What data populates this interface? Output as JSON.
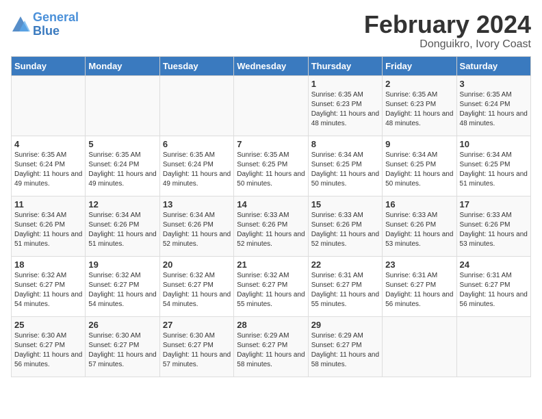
{
  "header": {
    "logo_line1": "General",
    "logo_line2": "Blue",
    "month": "February 2024",
    "location": "Donguikro, Ivory Coast"
  },
  "weekdays": [
    "Sunday",
    "Monday",
    "Tuesday",
    "Wednesday",
    "Thursday",
    "Friday",
    "Saturday"
  ],
  "weeks": [
    [
      {
        "day": "",
        "info": ""
      },
      {
        "day": "",
        "info": ""
      },
      {
        "day": "",
        "info": ""
      },
      {
        "day": "",
        "info": ""
      },
      {
        "day": "1",
        "info": "Sunrise: 6:35 AM\nSunset: 6:23 PM\nDaylight: 11 hours\nand 48 minutes."
      },
      {
        "day": "2",
        "info": "Sunrise: 6:35 AM\nSunset: 6:23 PM\nDaylight: 11 hours\nand 48 minutes."
      },
      {
        "day": "3",
        "info": "Sunrise: 6:35 AM\nSunset: 6:24 PM\nDaylight: 11 hours\nand 48 minutes."
      }
    ],
    [
      {
        "day": "4",
        "info": "Sunrise: 6:35 AM\nSunset: 6:24 PM\nDaylight: 11 hours\nand 49 minutes."
      },
      {
        "day": "5",
        "info": "Sunrise: 6:35 AM\nSunset: 6:24 PM\nDaylight: 11 hours\nand 49 minutes."
      },
      {
        "day": "6",
        "info": "Sunrise: 6:35 AM\nSunset: 6:24 PM\nDaylight: 11 hours\nand 49 minutes."
      },
      {
        "day": "7",
        "info": "Sunrise: 6:35 AM\nSunset: 6:25 PM\nDaylight: 11 hours\nand 50 minutes."
      },
      {
        "day": "8",
        "info": "Sunrise: 6:34 AM\nSunset: 6:25 PM\nDaylight: 11 hours\nand 50 minutes."
      },
      {
        "day": "9",
        "info": "Sunrise: 6:34 AM\nSunset: 6:25 PM\nDaylight: 11 hours\nand 50 minutes."
      },
      {
        "day": "10",
        "info": "Sunrise: 6:34 AM\nSunset: 6:25 PM\nDaylight: 11 hours\nand 51 minutes."
      }
    ],
    [
      {
        "day": "11",
        "info": "Sunrise: 6:34 AM\nSunset: 6:26 PM\nDaylight: 11 hours\nand 51 minutes."
      },
      {
        "day": "12",
        "info": "Sunrise: 6:34 AM\nSunset: 6:26 PM\nDaylight: 11 hours\nand 51 minutes."
      },
      {
        "day": "13",
        "info": "Sunrise: 6:34 AM\nSunset: 6:26 PM\nDaylight: 11 hours\nand 52 minutes."
      },
      {
        "day": "14",
        "info": "Sunrise: 6:33 AM\nSunset: 6:26 PM\nDaylight: 11 hours\nand 52 minutes."
      },
      {
        "day": "15",
        "info": "Sunrise: 6:33 AM\nSunset: 6:26 PM\nDaylight: 11 hours\nand 52 minutes."
      },
      {
        "day": "16",
        "info": "Sunrise: 6:33 AM\nSunset: 6:26 PM\nDaylight: 11 hours\nand 53 minutes."
      },
      {
        "day": "17",
        "info": "Sunrise: 6:33 AM\nSunset: 6:26 PM\nDaylight: 11 hours\nand 53 minutes."
      }
    ],
    [
      {
        "day": "18",
        "info": "Sunrise: 6:32 AM\nSunset: 6:27 PM\nDaylight: 11 hours\nand 54 minutes."
      },
      {
        "day": "19",
        "info": "Sunrise: 6:32 AM\nSunset: 6:27 PM\nDaylight: 11 hours\nand 54 minutes."
      },
      {
        "day": "20",
        "info": "Sunrise: 6:32 AM\nSunset: 6:27 PM\nDaylight: 11 hours\nand 54 minutes."
      },
      {
        "day": "21",
        "info": "Sunrise: 6:32 AM\nSunset: 6:27 PM\nDaylight: 11 hours\nand 55 minutes."
      },
      {
        "day": "22",
        "info": "Sunrise: 6:31 AM\nSunset: 6:27 PM\nDaylight: 11 hours\nand 55 minutes."
      },
      {
        "day": "23",
        "info": "Sunrise: 6:31 AM\nSunset: 6:27 PM\nDaylight: 11 hours\nand 56 minutes."
      },
      {
        "day": "24",
        "info": "Sunrise: 6:31 AM\nSunset: 6:27 PM\nDaylight: 11 hours\nand 56 minutes."
      }
    ],
    [
      {
        "day": "25",
        "info": "Sunrise: 6:30 AM\nSunset: 6:27 PM\nDaylight: 11 hours\nand 56 minutes."
      },
      {
        "day": "26",
        "info": "Sunrise: 6:30 AM\nSunset: 6:27 PM\nDaylight: 11 hours\nand 57 minutes."
      },
      {
        "day": "27",
        "info": "Sunrise: 6:30 AM\nSunset: 6:27 PM\nDaylight: 11 hours\nand 57 minutes."
      },
      {
        "day": "28",
        "info": "Sunrise: 6:29 AM\nSunset: 6:27 PM\nDaylight: 11 hours\nand 58 minutes."
      },
      {
        "day": "29",
        "info": "Sunrise: 6:29 AM\nSunset: 6:27 PM\nDaylight: 11 hours\nand 58 minutes."
      },
      {
        "day": "",
        "info": ""
      },
      {
        "day": "",
        "info": ""
      }
    ]
  ]
}
